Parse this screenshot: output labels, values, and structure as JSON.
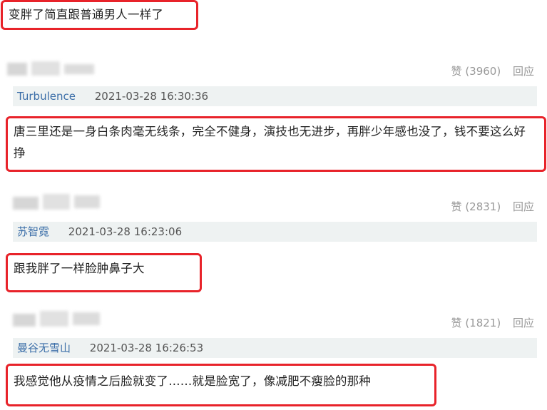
{
  "top_comment": {
    "text": "变胖了简直跟普通男人一样了"
  },
  "comments": [
    {
      "like_label": "赞 (3960)",
      "reply_label": "回应",
      "username": "Turbulence",
      "timestamp": "2021-03-28 16:30:36",
      "text": "唐三里还是一身白条肉毫无线条，完全不健身，演技也无进步，再胖少年感也没了，钱不要这么好挣"
    },
    {
      "like_label": "赞 (2831)",
      "reply_label": "回应",
      "username": "苏智霓",
      "timestamp": "2021-03-28 16:23:06",
      "text": "跟我胖了一样脸肿鼻子大"
    },
    {
      "like_label": "赞 (1821)",
      "reply_label": "回应",
      "username": "曼谷无雪山",
      "timestamp": "2021-03-28 16:26:53",
      "text": "我感觉他从疫情之后脸就变了……就是脸宽了，像减肥不瘦脸的那种"
    }
  ],
  "colors": {
    "highlight_border": "#e8232a",
    "username": "#3b6ea8",
    "meta_bg": "#eef2f2",
    "muted": "#999999"
  }
}
